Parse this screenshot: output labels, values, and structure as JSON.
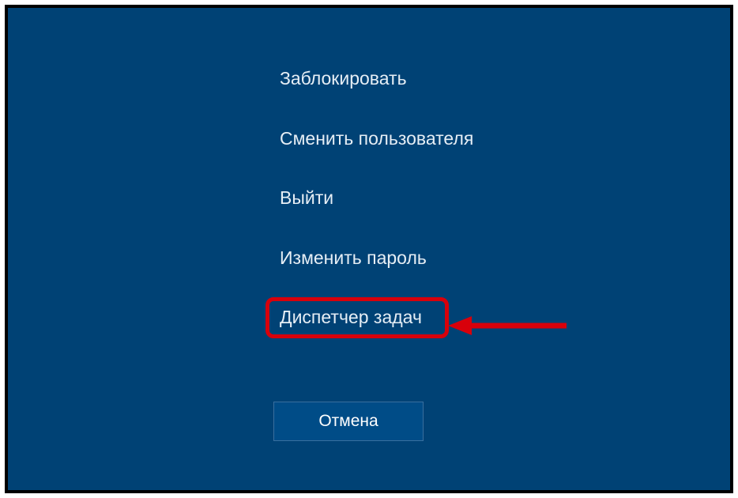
{
  "menu": {
    "items": [
      {
        "label": "Заблокировать"
      },
      {
        "label": "Сменить пользователя"
      },
      {
        "label": "Выйти"
      },
      {
        "label": "Изменить пароль"
      },
      {
        "label": "Диспетчер задач"
      }
    ]
  },
  "cancel": {
    "label": "Отмена"
  },
  "annotation": {
    "color": "#d8000b"
  }
}
